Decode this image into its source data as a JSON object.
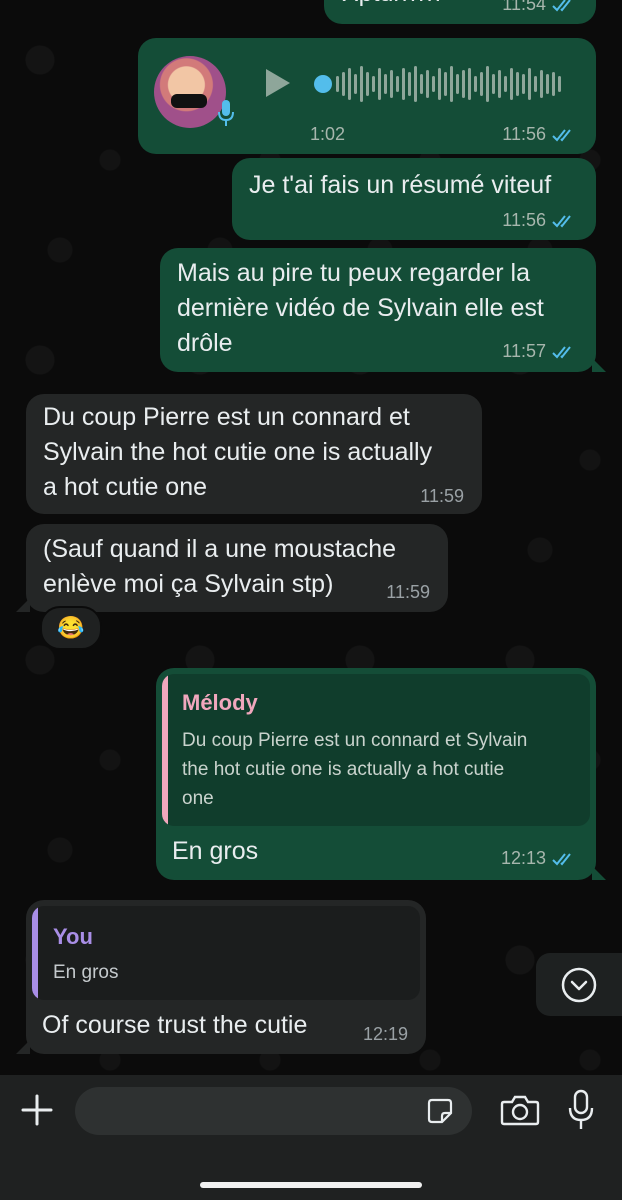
{
  "messages": {
    "m1": {
      "text": "Xptdrrrrrr",
      "time": "11:54"
    },
    "voice": {
      "duration": "1:02",
      "time": "11:56"
    },
    "m2": {
      "text": "Je t'ai fais un résumé viteuf",
      "time": "11:56"
    },
    "m3": {
      "line1": "Mais au pire tu peux regarder la",
      "line2": "dernière vidéo de Sylvain elle est",
      "line3": "drôle",
      "time": "11:57"
    },
    "m4": {
      "line1": "Du coup Pierre est un connard et",
      "line2": "Sylvain the hot cutie one is actually",
      "line3": "a hot cutie one",
      "time": "11:59"
    },
    "m5": {
      "line1": "(Sauf quand il a une moustache",
      "line2": "enlève moi ça Sylvain stp)",
      "time": "11:59",
      "reaction": "😂"
    },
    "m6": {
      "quote_author": "Mélody",
      "quote_line1": "Du coup Pierre est un connard et Sylvain",
      "quote_line2": "the hot cutie one is actually a hot cutie",
      "quote_line3": "one",
      "text": "En gros",
      "time": "12:13"
    },
    "m7": {
      "quote_author": "You",
      "quote_text": "En gros",
      "text": "Of course trust the cutie",
      "time": "12:19"
    }
  },
  "colors": {
    "outgoing_bubble": "#144d37",
    "incoming_bubble": "#242626",
    "read_ticks": "#53bdeb",
    "quote_melody": "#f1a7bd",
    "quote_you": "#a98ee6"
  },
  "icons": {
    "add": "plus-icon",
    "sticker": "sticker-icon",
    "camera": "camera-icon",
    "mic": "microphone-icon",
    "scroll": "chevron-down-icon",
    "play": "play-icon"
  }
}
